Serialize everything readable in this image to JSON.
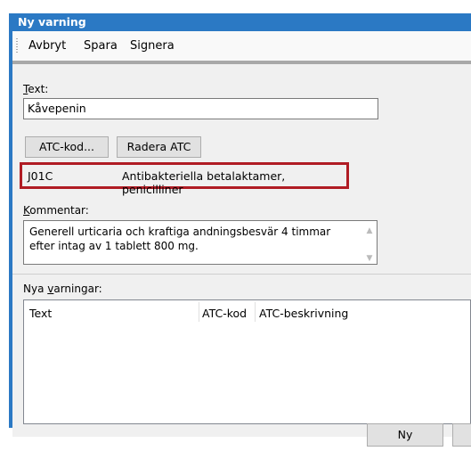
{
  "window": {
    "title": "Ny varning"
  },
  "toolbar": {
    "cancel_label": "Avbryt",
    "save_label": "Spara",
    "sign_label": "Signera"
  },
  "form": {
    "text_label_u": "T",
    "text_label_rest": "ext:",
    "text_value": "Kåvepenin",
    "atc_code_button": "ATC-kod...",
    "remove_atc_button": "Radera ATC",
    "atc_code": "J01C",
    "atc_description": "Antibakteriella betalaktamer, penicilliner",
    "comment_label_u": "K",
    "comment_label_rest": "ommentar:",
    "comment_line1": "Generell urticaria och kraftiga andningsbesvär 4 timmar",
    "comment_line2": "efter intag av 1 tablett 800 mg."
  },
  "warnings": {
    "label_pre": "Nya ",
    "label_u": "v",
    "label_post": "arningar:",
    "columns": [
      "Text",
      "ATC-kod",
      "ATC-beskrivning"
    ],
    "rows": []
  },
  "footer": {
    "new_button": "Ny"
  },
  "colors": {
    "title_bar": "#2b79c4",
    "highlight_border": "#b01c24"
  }
}
